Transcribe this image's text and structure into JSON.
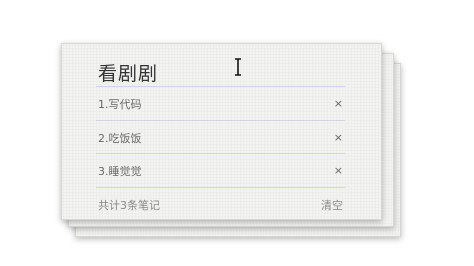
{
  "card": {
    "title": "看剧剧",
    "items": [
      {
        "label": "1.写代码"
      },
      {
        "label": "2.吃饭饭"
      },
      {
        "label": "3.睡觉觉"
      }
    ],
    "remove_symbol": "×",
    "footer": {
      "count_text": "共计3条笔记",
      "clear_label": "清空"
    }
  },
  "cursor_icon": "text-cursor-icon"
}
